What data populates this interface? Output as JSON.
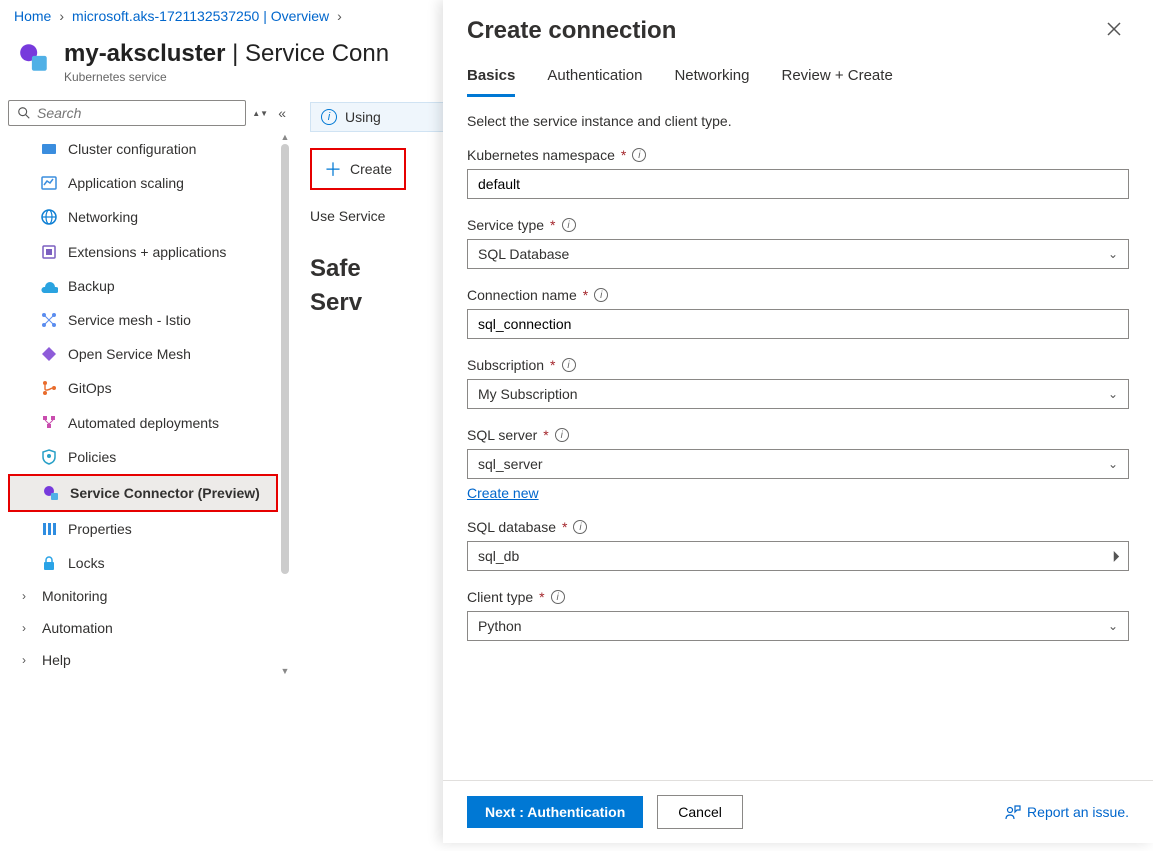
{
  "breadcrumb": {
    "home": "Home",
    "resource": "microsoft.aks-1721132537250 | Overview"
  },
  "header": {
    "title_main": "my-akscluster",
    "title_section": "Service Conn",
    "subtitle": "Kubernetes service"
  },
  "search": {
    "placeholder": "Search"
  },
  "sidebar": {
    "items": [
      {
        "label": "Cluster configuration"
      },
      {
        "label": "Application scaling"
      },
      {
        "label": "Networking"
      },
      {
        "label": "Extensions + applications"
      },
      {
        "label": "Backup"
      },
      {
        "label": "Service mesh - Istio"
      },
      {
        "label": "Open Service Mesh"
      },
      {
        "label": "GitOps"
      },
      {
        "label": "Automated deployments"
      },
      {
        "label": "Policies"
      },
      {
        "label": "Service Connector (Preview)"
      },
      {
        "label": "Properties"
      },
      {
        "label": "Locks"
      }
    ],
    "groups": [
      {
        "label": "Monitoring"
      },
      {
        "label": "Automation"
      },
      {
        "label": "Help"
      }
    ]
  },
  "main": {
    "info_banner": "Using",
    "create_label": "Create",
    "use_line": "Use Service",
    "big_heading_line1": "Safe",
    "big_heading_line2": "Serv"
  },
  "blade": {
    "title": "Create connection",
    "tabs": [
      "Basics",
      "Authentication",
      "Networking",
      "Review + Create"
    ],
    "intro": "Select the service instance and client type.",
    "fields": {
      "namespace": {
        "label": "Kubernetes namespace",
        "value": "default"
      },
      "service_type": {
        "label": "Service type",
        "value": "SQL Database"
      },
      "connection_name": {
        "label": "Connection name",
        "value": "sql_connection"
      },
      "subscription": {
        "label": "Subscription",
        "value": "My Subscription"
      },
      "sql_server": {
        "label": "SQL server",
        "value": "sql_server",
        "create_new": "Create new"
      },
      "sql_database": {
        "label": "SQL database",
        "value": "sql_db"
      },
      "client_type": {
        "label": "Client type",
        "value": "Python"
      }
    },
    "footer": {
      "next": "Next : Authentication",
      "cancel": "Cancel",
      "report": "Report an issue."
    }
  }
}
